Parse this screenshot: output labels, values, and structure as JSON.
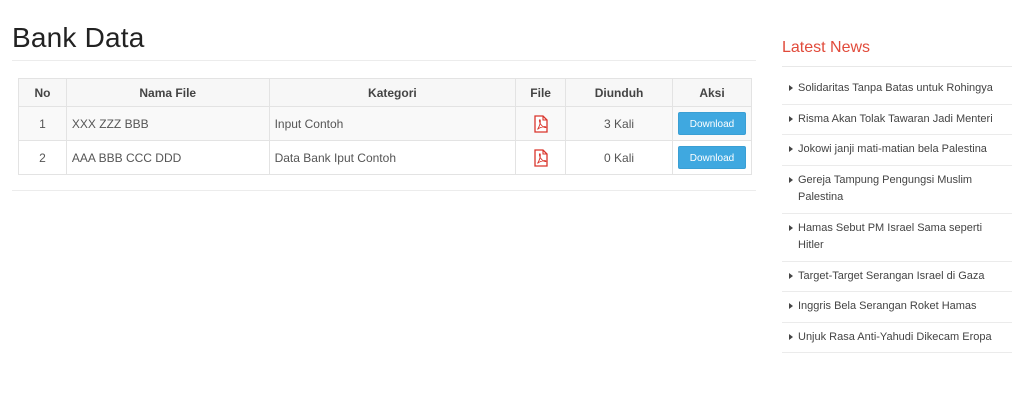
{
  "page": {
    "title": "Bank Data"
  },
  "table": {
    "headers": {
      "no": "No",
      "nama_file": "Nama File",
      "kategori": "Kategori",
      "file": "File",
      "diunduh": "Diunduh",
      "aksi": "Aksi"
    },
    "rows": [
      {
        "no": "1",
        "nama_file": "XXX ZZZ BBB",
        "kategori": "Input Contoh",
        "file_icon": "pdf-icon",
        "diunduh": "3 Kali",
        "action_label": "Download"
      },
      {
        "no": "2",
        "nama_file": "AAA BBB CCC DDD",
        "kategori": "Data Bank Iput Contoh",
        "file_icon": "pdf-icon",
        "diunduh": "0 Kali",
        "action_label": "Download"
      }
    ]
  },
  "sidebar": {
    "title": "Latest News",
    "news": [
      "Solidaritas Tanpa Batas untuk Rohingya",
      "Risma Akan Tolak Tawaran Jadi Menteri",
      "Jokowi janji mati-matian bela Palestina",
      "Gereja Tampung Pengungsi Muslim Palestina",
      "Hamas Sebut PM Israel Sama seperti Hitler",
      "Target-Target Serangan Israel di Gaza",
      "Inggris Bela Serangan Roket Hamas",
      "Unjuk Rasa Anti-Yahudi Dikecam Eropa"
    ]
  },
  "colors": {
    "accent_red": "#e14b3b",
    "button_blue": "#3fa8e0",
    "pdf_red": "#d9342b"
  }
}
